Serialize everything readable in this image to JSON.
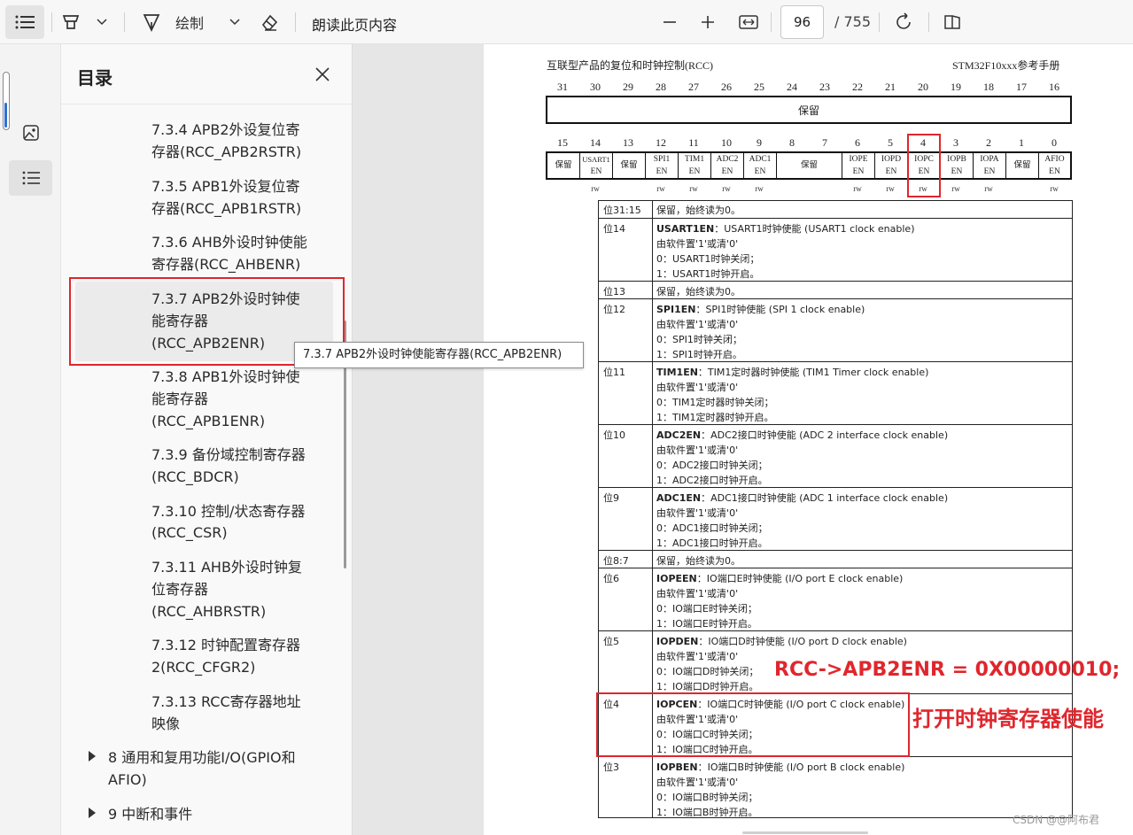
{
  "toolbar": {
    "draw_label": "绘制",
    "read_aloud_label": "朗读此页内容",
    "page_current": "96",
    "page_total": "/ 755"
  },
  "toc": {
    "title": "目录",
    "items": [
      "7.3.4 APB2外设复位寄",
      "存器(RCC_APB2RSTR)",
      "7.3.5 APB1外设复位寄",
      "存器(RCC_APB1RSTR)",
      "7.3.6 AHB外设时钟使能",
      "寄存器(RCC_AHBENR)",
      "7.3.7 APB2外设时钟使",
      "能寄存器",
      "(RCC_APB2ENR)",
      "7.3.8 APB1外设时钟使",
      "能寄存器",
      "(RCC_APB1ENR)",
      "7.3.9 备份域控制寄存器",
      "(RCC_BDCR)",
      "7.3.10 控制/状态寄存器",
      "(RCC_CSR)",
      "7.3.11 AHB外设时钟复",
      "位寄存器",
      "(RCC_AHBRSTR)",
      "7.3.12 时钟配置寄存器",
      "2(RCC_CFGR2)",
      "7.3.13 RCC寄存器地址",
      "映像"
    ],
    "chapter8_line1": "8 通用和复用功能I/O(GPIO和",
    "chapter8_line2": "AFIO)",
    "chapter9": "9 中断和事件",
    "tooltip": "7.3.7 APB2外设时钟使能寄存器(RCC_APB2ENR)"
  },
  "doc": {
    "header_left": "互联型产品的复位和时钟控制(RCC)",
    "header_right": "STM32F10xxx参考手册",
    "high_bits": [
      "31",
      "30",
      "29",
      "28",
      "27",
      "26",
      "25",
      "24",
      "23",
      "22",
      "21",
      "20",
      "19",
      "18",
      "17",
      "16"
    ],
    "reserved_label": "保留",
    "low_bits": [
      "15",
      "14",
      "13",
      "12",
      "11",
      "10",
      "9",
      "8",
      "7",
      "6",
      "5",
      "4",
      "3",
      "2",
      "1",
      "0"
    ],
    "fields": [
      {
        "l1": "保留",
        "l2": ""
      },
      {
        "l1": "USART1",
        "l2": "EN"
      },
      {
        "l1": "保留",
        "l2": ""
      },
      {
        "l1": "SPI1",
        "l2": "EN"
      },
      {
        "l1": "TIM1",
        "l2": "EN"
      },
      {
        "l1": "ADC2",
        "l2": "EN"
      },
      {
        "l1": "ADC1",
        "l2": "EN"
      },
      {
        "l1": "保留",
        "l2": ""
      },
      {
        "l1": "IOPE",
        "l2": "EN"
      },
      {
        "l1": "IOPD",
        "l2": "EN"
      },
      {
        "l1": "IOPC",
        "l2": "EN"
      },
      {
        "l1": "IOPB",
        "l2": "EN"
      },
      {
        "l1": "IOPA",
        "l2": "EN"
      },
      {
        "l1": "保留",
        "l2": ""
      },
      {
        "l1": "AFIO",
        "l2": "EN"
      }
    ],
    "rw": "rw",
    "rows": [
      {
        "bit": "位31:15",
        "lines": [
          "保留，始终读为0。"
        ]
      },
      {
        "bit": "位14",
        "name": "USART1EN",
        "title": "：USART1时钟使能 (USART1 clock enable)",
        "lines": [
          "由软件置'1'或清'0'",
          "0：USART1时钟关闭；",
          "1：USART1时钟开启。"
        ]
      },
      {
        "bit": "位13",
        "lines": [
          "保留，始终读为0。"
        ]
      },
      {
        "bit": "位12",
        "name": "SPI1EN",
        "title": "：SPI1时钟使能 (SPI 1 clock enable)",
        "lines": [
          "由软件置'1'或清'0'",
          "0：SPI1时钟关闭；",
          "1：SPI1时钟开启。"
        ]
      },
      {
        "bit": "位11",
        "name": "TIM1EN",
        "title": "：TIM1定时器时钟使能 (TIM1 Timer clock enable)",
        "lines": [
          "由软件置'1'或清'0'",
          "0：TIM1定时器时钟关闭；",
          "1：TIM1定时器时钟开启。"
        ]
      },
      {
        "bit": "位10",
        "name": "ADC2EN",
        "title": "：ADC2接口时钟使能 (ADC 2 interface clock enable)",
        "lines": [
          "由软件置'1'或清'0'",
          "0：ADC2接口时钟关闭；",
          "1：ADC2接口时钟开启。"
        ]
      },
      {
        "bit": "位9",
        "name": "ADC1EN",
        "title": "：ADC1接口时钟使能 (ADC 1 interface clock enable)",
        "lines": [
          "由软件置'1'或清'0'",
          "0：ADC1接口时钟关闭；",
          "1：ADC1接口时钟开启。"
        ]
      },
      {
        "bit": "位8:7",
        "lines": [
          "保留，始终读为0。"
        ]
      },
      {
        "bit": "位6",
        "name": "IOPEEN",
        "title": "：IO端口E时钟使能 (I/O port E clock enable)",
        "lines": [
          "由软件置'1'或清'0'",
          "0：IO端口E时钟关闭；",
          "1：IO端口E时钟开启。"
        ]
      },
      {
        "bit": "位5",
        "name": "IOPDEN",
        "title": "：IO端口D时钟使能 (I/O port D clock enable)",
        "lines": [
          "由软件置'1'或清'0'",
          "0：IO端口D时钟关闭；",
          "1：IO端口D时钟开启。"
        ]
      },
      {
        "bit": "位4",
        "name": "IOPCEN",
        "title": "：IO端口C时钟使能 (I/O port C clock enable)",
        "lines": [
          "由软件置'1'或清'0'",
          "0：IO端口C时钟关闭；",
          "1：IO端口C时钟开启。"
        ]
      },
      {
        "bit": "位3",
        "name": "IOPBEN",
        "title": "：IO端口B时钟使能 (I/O port B clock enable)",
        "lines": [
          "由软件置'1'或清'0'",
          "0：IO端口B时钟关闭；",
          "1：IO端口B时钟开启。"
        ]
      }
    ],
    "annotation_code": "RCC->APB2ENR = 0X00000010;",
    "annotation_note": "打开时钟寄存器使能",
    "watermark": "CSDN @@阿布君",
    "accent_red": "#e0262d"
  }
}
